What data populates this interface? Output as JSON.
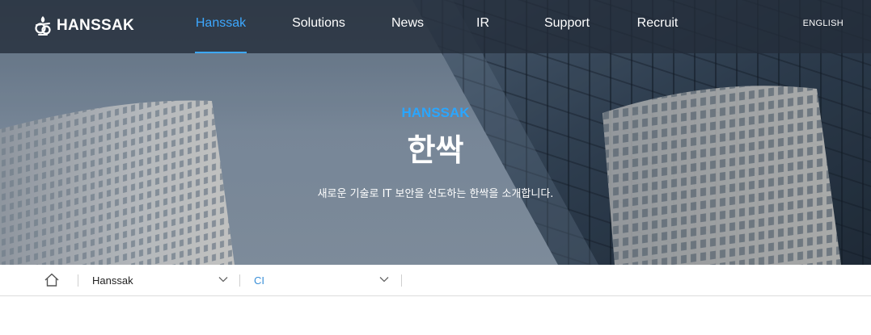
{
  "header": {
    "logo_text": "HANSSAK",
    "nav": [
      {
        "label": "Hanssak",
        "active": true
      },
      {
        "label": "Solutions",
        "active": false
      },
      {
        "label": "News",
        "active": false
      },
      {
        "label": "IR",
        "active": false
      },
      {
        "label": "Support",
        "active": false
      },
      {
        "label": "Recruit",
        "active": false
      }
    ],
    "language": "ENGLISH"
  },
  "hero": {
    "eyebrow": "HANSSAK",
    "title": "한싹",
    "subtitle": "새로운 기술로 IT 보안을 선도하는 한싹을 소개합니다."
  },
  "breadcrumb": {
    "home_icon": "home-icon",
    "items": [
      {
        "label": "Hanssak",
        "current": false
      },
      {
        "label": "CI",
        "current": true
      }
    ]
  },
  "colors": {
    "accent": "#3da8ff",
    "header_bg": "#222c38",
    "crumb_current": "#3a8fd8"
  }
}
